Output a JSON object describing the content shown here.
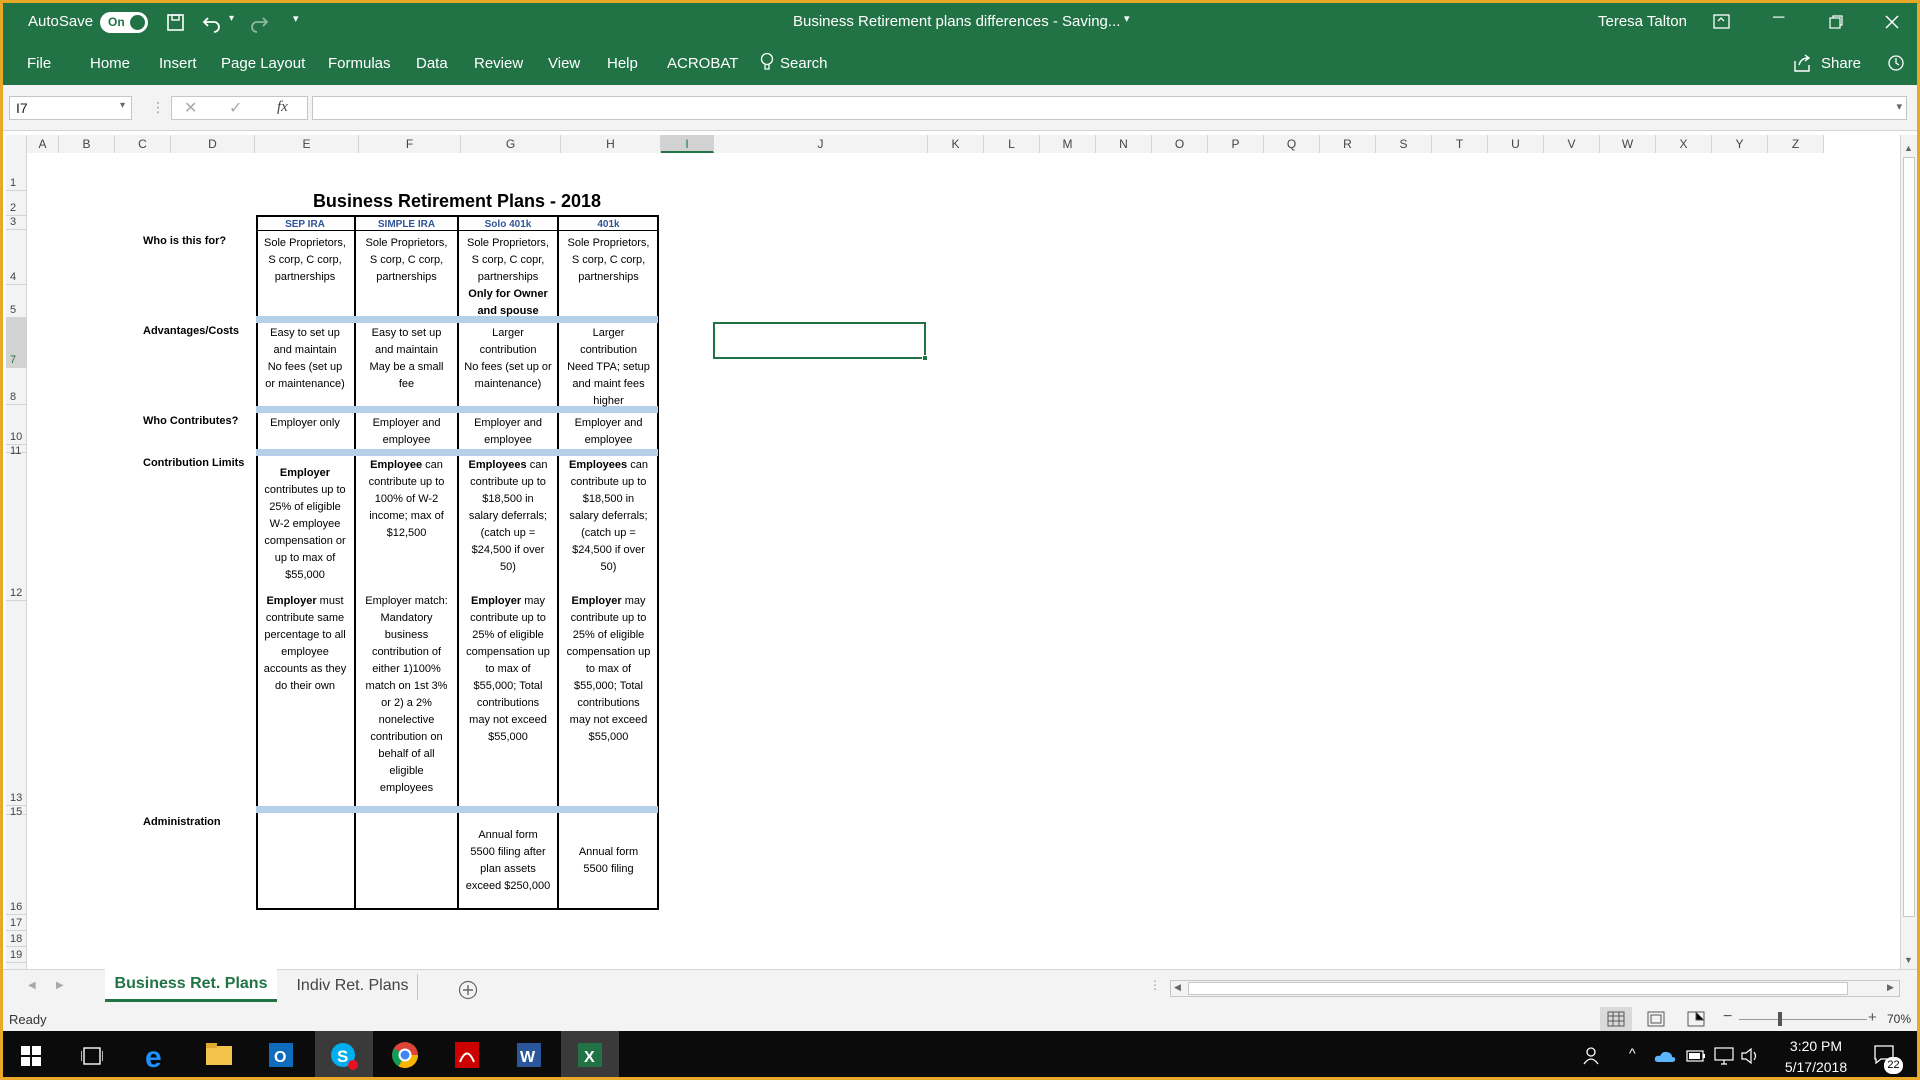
{
  "window": {
    "autosave_label": "AutoSave",
    "autosave_state": "On",
    "title": "Business Retirement plans differences  -  Saving...",
    "user": "Teresa Talton"
  },
  "menu": [
    "File",
    "Home",
    "Insert",
    "Page Layout",
    "Formulas",
    "Data",
    "Review",
    "View",
    "Help",
    "ACROBAT"
  ],
  "search_label": "Search",
  "share_label": "Share",
  "formula": {
    "name_box": "I7",
    "fx": "fx",
    "value": ""
  },
  "columns": [
    "A",
    "B",
    "C",
    "D",
    "E",
    "F",
    "G",
    "H",
    "I",
    "J",
    "K",
    "L",
    "M",
    "N",
    "O",
    "P",
    "Q",
    "R",
    "S",
    "T",
    "U",
    "V",
    "W",
    "X",
    "Y",
    "Z"
  ],
  "rows": [
    "1",
    "2",
    "3",
    "4",
    "5",
    "7",
    "8",
    "10",
    "11",
    "12",
    "13",
    "15",
    "16",
    "17",
    "18",
    "19"
  ],
  "sheet": {
    "title": "Business Retirement Plans - 2018",
    "plans": [
      "SEP IRA",
      "SIMPLE IRA",
      "Solo 401k",
      "401k"
    ],
    "row_labels": {
      "who": "Who is this for?",
      "adv": "Advantages/Costs",
      "contrib": "Who Contributes?",
      "limits": "Contribution Limits",
      "admin": "Administration"
    },
    "who": [
      [
        "Sole Proprietors,",
        "S corp, C corp,",
        "partnerships"
      ],
      [
        "Sole Proprietors,",
        "S corp, C corp,",
        "partnerships"
      ],
      [
        "Sole Proprietors,",
        "S corp, C copr,",
        "partnerships",
        "Only for Owner",
        "and spouse"
      ],
      [
        "Sole Proprietors,",
        "S corp, C corp,",
        "partnerships"
      ]
    ],
    "adv": [
      [
        "Easy to set up",
        "and maintain",
        "No fees (set up",
        "or maintenance)"
      ],
      [
        "Easy to set up",
        "and maintain",
        "May be a small",
        "fee"
      ],
      [
        "Larger",
        "contribution",
        "No fees (set up or",
        "maintenance)"
      ],
      [
        "Larger",
        "contribution",
        "Need TPA; setup",
        "and maint fees",
        "higher"
      ]
    ],
    "contrib": [
      [
        "Employer only"
      ],
      [
        "Employer and",
        "employee"
      ],
      [
        "Employer and",
        "employee"
      ],
      [
        "Employer and",
        "employee"
      ]
    ],
    "limits_a": [
      [
        "Employer",
        "contributes up to",
        "25% of eligible",
        "W-2 employee",
        "compensation or",
        "up to max of",
        "$55,000"
      ],
      [
        "Employee can",
        "contribute up to",
        "100% of W-2",
        "income; max of",
        "$12,500"
      ],
      [
        "Employees can",
        "contribute up to",
        "$18,500 in",
        "salary deferrals;",
        "(catch up =",
        "$24,500 if over",
        "50)"
      ],
      [
        "Employees can",
        "contribute up to",
        "$18,500 in",
        "salary deferrals;",
        "(catch up =",
        "$24,500 if over",
        "50)"
      ]
    ],
    "limits_b": [
      [
        "Employer must",
        "contribute same",
        "percentage to all",
        "employee",
        "accounts as they",
        "do their own"
      ],
      [
        "Employer match:",
        "Mandatory",
        "business",
        "contribution of",
        "either 1)100%",
        "match on 1st 3%",
        "or 2) a 2%",
        "nonelective",
        "contribution on",
        "behalf of all",
        "eligible",
        "employees"
      ],
      [
        "Employer may",
        "contribute up to",
        "25% of eligible",
        "compensation up",
        "to max of",
        "$55,000; Total",
        "contributions",
        "may not exceed",
        "$55,000"
      ],
      [
        "Employer may",
        "contribute up to",
        "25% of eligible",
        "compensation up",
        "to max of",
        "$55,000; Total",
        "contributions",
        "may not exceed",
        "$55,000"
      ]
    ],
    "admin": [
      [],
      [],
      [
        "Annual form",
        "5500 filing after",
        "plan assets",
        "exceed $250,000"
      ],
      [
        "Annual form",
        "5500 filing"
      ]
    ]
  },
  "tabs": [
    "Business Ret. Plans",
    "Indiv Ret. Plans"
  ],
  "status": {
    "ready": "Ready",
    "zoom": "70%"
  },
  "clock": {
    "time": "3:20 PM",
    "date": "5/17/2018",
    "notifications": "22"
  }
}
